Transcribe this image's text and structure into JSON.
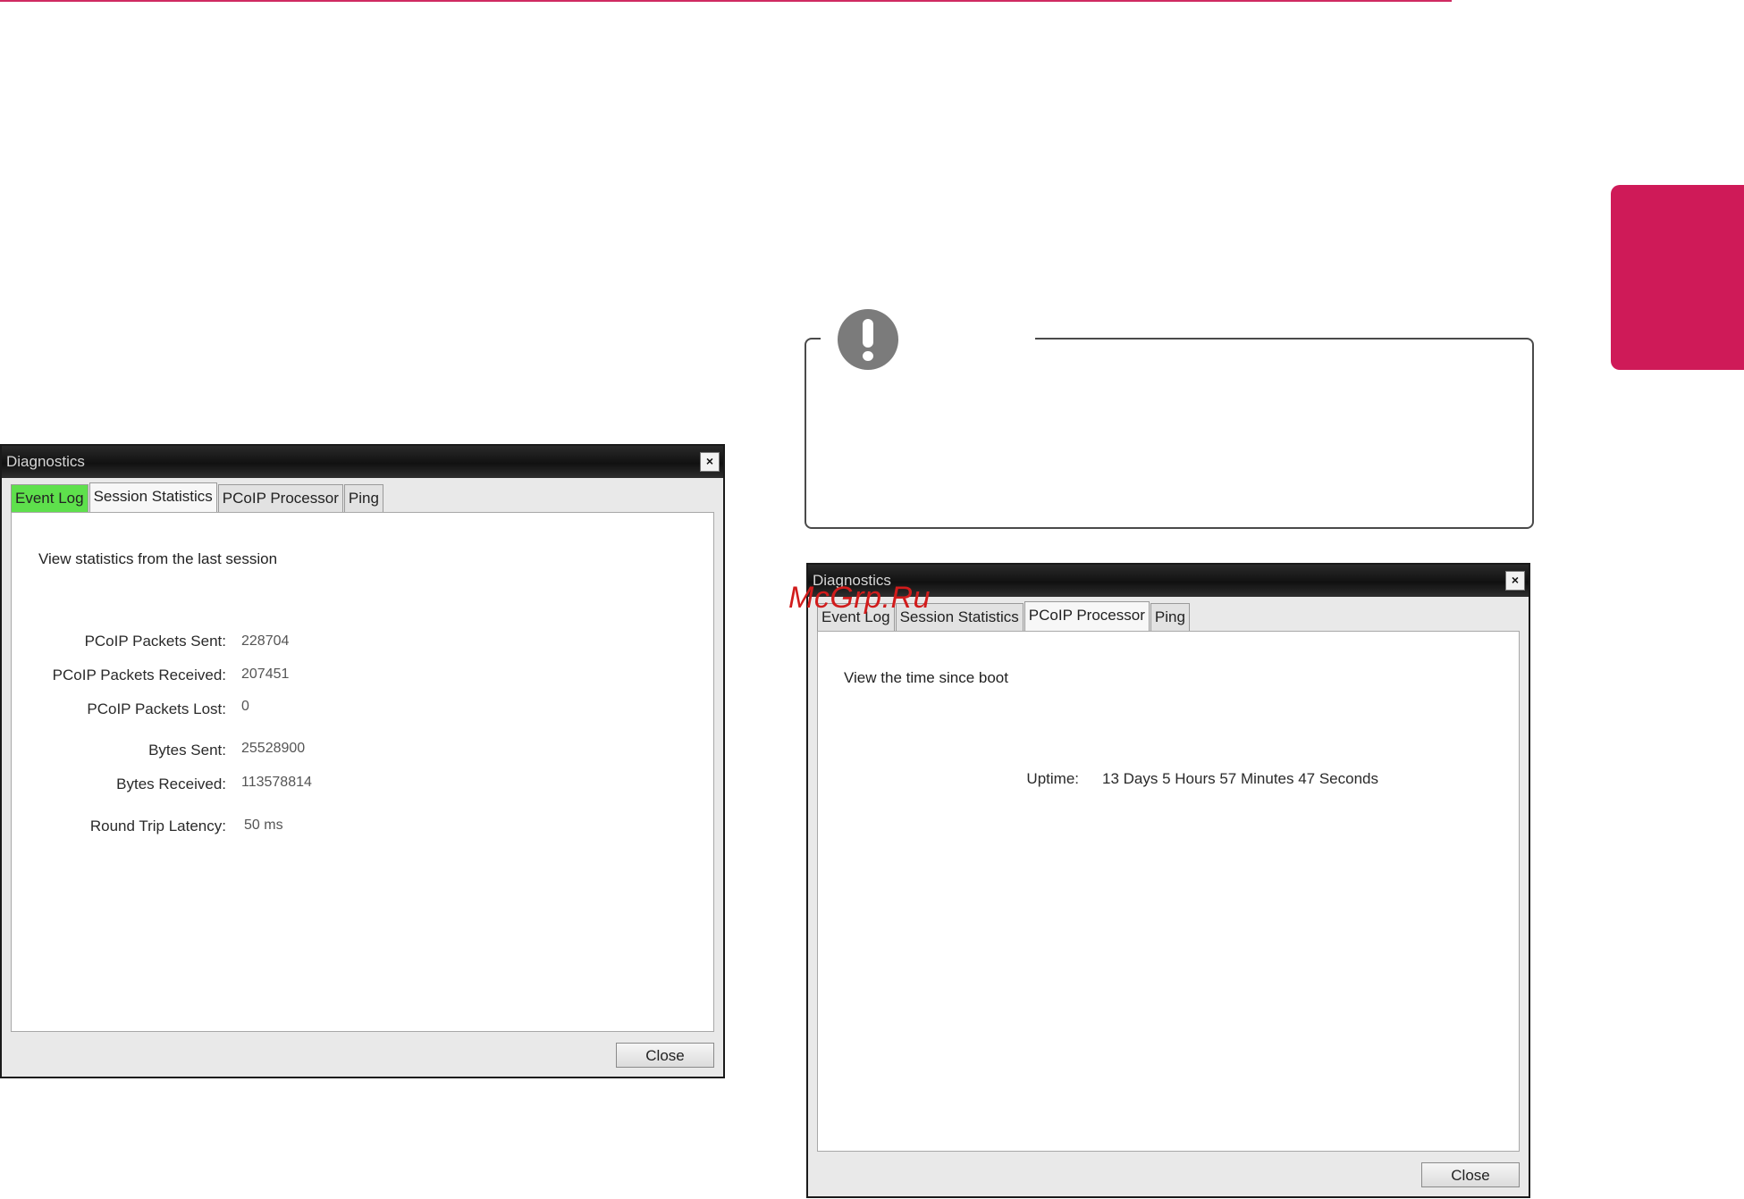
{
  "dialog_left": {
    "title": "Diagnostics",
    "close_glyph": "×",
    "tabs": [
      "Event Log",
      "Session Statistics",
      "PCoIP Processor",
      "Ping"
    ],
    "active_tab": "Session Statistics",
    "intro": "View statistics from the last session",
    "stats": [
      {
        "label": "PCoIP Packets Sent:",
        "value": "228704"
      },
      {
        "label": "PCoIP Packets Received:",
        "value": "207451"
      },
      {
        "label": "PCoIP Packets Lost:",
        "value": "0"
      },
      {
        "label": "Bytes Sent:",
        "value": "25528900"
      },
      {
        "label": "Bytes Received:",
        "value": "113578814"
      },
      {
        "label": "Round Trip Latency:",
        "value": "50 ms"
      }
    ],
    "close_button": "Close"
  },
  "dialog_right": {
    "title": "Diagnostics",
    "close_glyph": "×",
    "tabs": [
      "Event Log",
      "Session Statistics",
      "PCoIP Processor",
      "Ping"
    ],
    "active_tab": "PCoIP Processor",
    "intro": "View the time since boot",
    "uptime_label": "Uptime:",
    "uptime_value": "13 Days 5 Hours 57 Minutes 47 Seconds",
    "close_button": "Close"
  },
  "watermark": "McGrp.Ru",
  "colors": {
    "accent": "#cf1a58",
    "tab_highlight": "#5ee04c",
    "watermark": "#d11c1c"
  },
  "icons": {
    "note": "exclamation-circle-icon"
  }
}
